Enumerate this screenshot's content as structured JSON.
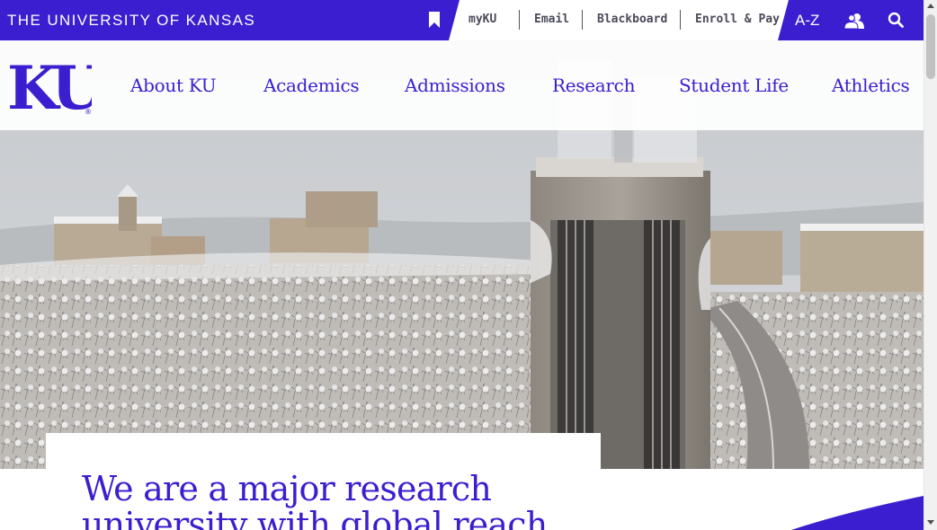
{
  "topbar": {
    "university_name": "THE UNIVERSITY OF KANSAS",
    "quicklinks": [
      "myKU",
      "Email",
      "Blackboard",
      "Enroll & Pay"
    ],
    "az_label": "A-Z",
    "icons": [
      "bookmark-icon",
      "people-icon",
      "search-icon"
    ]
  },
  "logo": {
    "text": "KU",
    "registered": "®"
  },
  "nav": {
    "items": [
      "About KU",
      "Academics",
      "Admissions",
      "Research",
      "Student Life",
      "Athletics"
    ]
  },
  "hero": {
    "headline": "We are a major research university with global reach"
  },
  "colors": {
    "brand_blue": "#3b1ecf",
    "quicklink_text": "#4a4a5a"
  }
}
